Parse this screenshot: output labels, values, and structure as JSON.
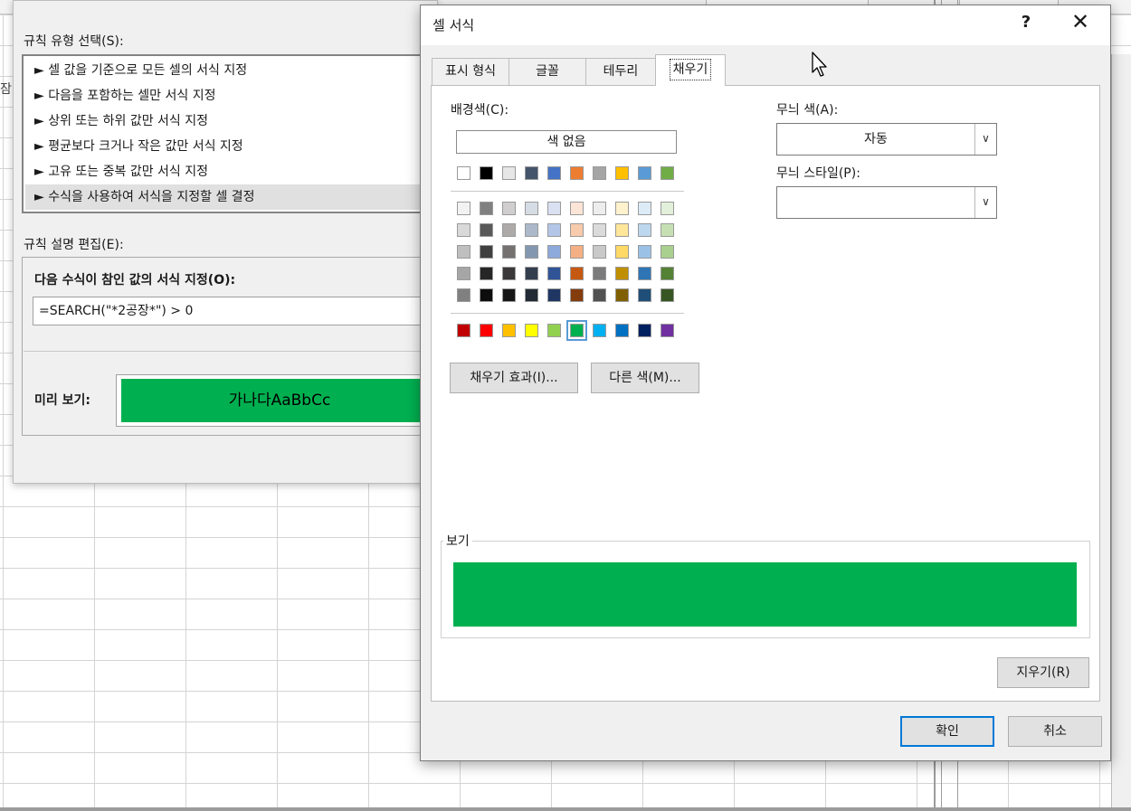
{
  "background_sheet": {
    "cut_text": "잠"
  },
  "cf_dialog": {
    "rule_type_label": "규칙 유형 선택(S):",
    "rule_types": [
      "► 셀 값을 기준으로 모든 셀의 서식 지정",
      "► 다음을 포함하는 셀만 서식 지정",
      "► 상위 또는 하위 값만 서식 지정",
      "► 평균보다 크거나 작은 값만 서식 지정",
      "► 고유 또는 중복 값만 서식 지정",
      "► 수식을 사용하여 서식을 지정할 셀 결정"
    ],
    "selected_index": 5,
    "description_label": "규칙 설명 편집(E):",
    "formula_label": "다음 수식이 참인 값의 서식 지정(O):",
    "formula_value": "=SEARCH(\"*2공장*\") > 0",
    "preview_label": "미리 보기:",
    "preview_text": "가나다AaBbCc",
    "preview_fill_color": "#00b050"
  },
  "format_cells": {
    "title": "셀 서식",
    "help": "?",
    "close": "✕",
    "tabs": [
      "표시 형식",
      "글꼴",
      "테두리",
      "채우기"
    ],
    "active_tab": "채우기",
    "background_color_label": "배경색(C):",
    "no_color_label": "색 없음",
    "theme_colors": [
      "#ffffff",
      "#000000",
      "#e7e6e6",
      "#44546a",
      "#4472c4",
      "#ed7d31",
      "#a5a5a5",
      "#ffc000",
      "#5b9bd5",
      "#70ad47"
    ],
    "tints": [
      [
        "#f2f2f2",
        "#808080",
        "#d0cece",
        "#d6dce4",
        "#d9e1f2",
        "#fce4d6",
        "#ededed",
        "#fff2cc",
        "#ddebf7",
        "#e2efda"
      ],
      [
        "#d9d9d9",
        "#595959",
        "#aeaaaa",
        "#acb9ca",
        "#b4c6e7",
        "#f8cbad",
        "#dbdbdb",
        "#ffe699",
        "#bdd7ee",
        "#c6e0b4"
      ],
      [
        "#bfbfbf",
        "#404040",
        "#757171",
        "#8497b0",
        "#8ea9db",
        "#f4b084",
        "#c9c9c9",
        "#ffd966",
        "#9bc2e6",
        "#a9d08e"
      ],
      [
        "#a6a6a6",
        "#262626",
        "#3a3838",
        "#333f4f",
        "#305496",
        "#c65911",
        "#7b7b7b",
        "#bf8f00",
        "#2f75b5",
        "#548235"
      ],
      [
        "#808080",
        "#0d0d0d",
        "#161616",
        "#222b35",
        "#203764",
        "#833c0c",
        "#525252",
        "#806000",
        "#1f4e78",
        "#375623"
      ]
    ],
    "standard_colors": [
      "#c00000",
      "#ff0000",
      "#ffc000",
      "#ffff00",
      "#92d050",
      "#00b050",
      "#00b0f0",
      "#0070c0",
      "#002060",
      "#7030a0"
    ],
    "selected_standard_index": 5,
    "fill_effects_label": "채우기 효과(I)...",
    "more_colors_label": "다른 색(M)...",
    "pattern_color_label": "무늬 색(A):",
    "pattern_color_value": "자동",
    "pattern_style_label": "무늬 스타일(P):",
    "pattern_style_value": "",
    "sample_label": "보기",
    "sample_color": "#00b050",
    "clear_label": "지우기(R)",
    "ok_label": "확인",
    "cancel_label": "취소"
  }
}
